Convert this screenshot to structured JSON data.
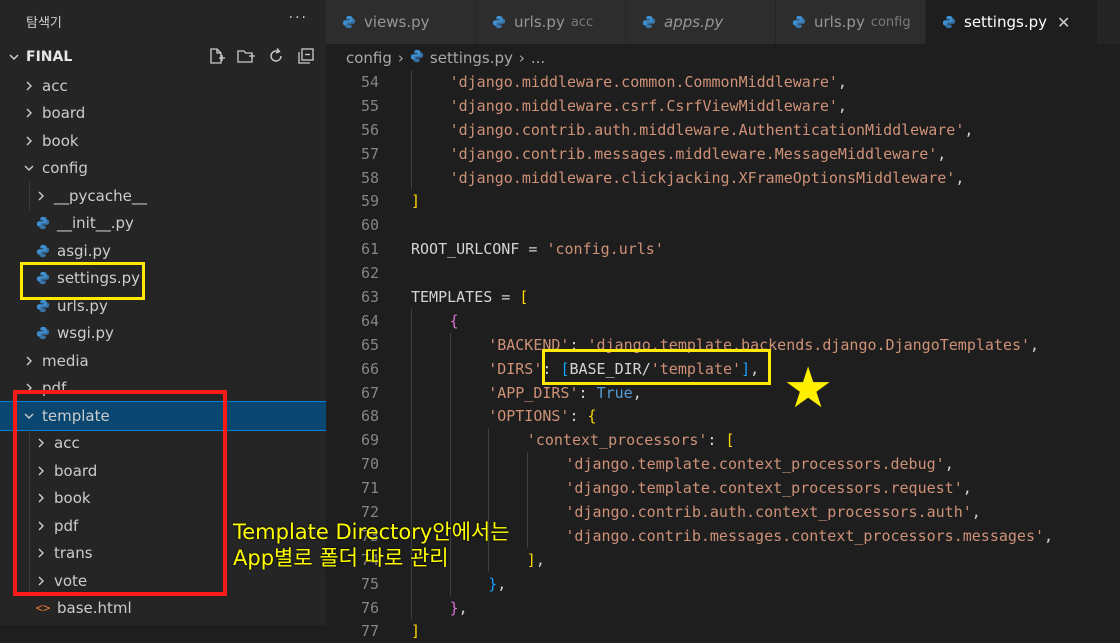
{
  "sidebar": {
    "title": "탐색기",
    "more": "···",
    "section_title": "FINAL",
    "actions": [
      "new-file-icon",
      "new-folder-icon",
      "refresh-icon",
      "collapse-all-icon"
    ],
    "tree": [
      {
        "label": "acc",
        "type": "folder",
        "open": false,
        "level": 0
      },
      {
        "label": "board",
        "type": "folder",
        "open": false,
        "level": 0
      },
      {
        "label": "book",
        "type": "folder",
        "open": false,
        "level": 0
      },
      {
        "label": "config",
        "type": "folder",
        "open": true,
        "level": 0
      },
      {
        "label": "__pycache__",
        "type": "folder",
        "open": false,
        "level": 1
      },
      {
        "label": "__init__.py",
        "type": "py",
        "level": 1
      },
      {
        "label": "asgi.py",
        "type": "py",
        "level": 1
      },
      {
        "label": "settings.py",
        "type": "py",
        "level": 1
      },
      {
        "label": "urls.py",
        "type": "py",
        "level": 1
      },
      {
        "label": "wsgi.py",
        "type": "py",
        "level": 1
      },
      {
        "label": "media",
        "type": "folder",
        "open": false,
        "level": 0
      },
      {
        "label": "pdf",
        "type": "folder",
        "open": false,
        "level": 0
      },
      {
        "label": "template",
        "type": "folder",
        "open": true,
        "level": 0,
        "selected": true
      },
      {
        "label": "acc",
        "type": "folder",
        "open": false,
        "level": 1
      },
      {
        "label": "board",
        "type": "folder",
        "open": false,
        "level": 1
      },
      {
        "label": "book",
        "type": "folder",
        "open": false,
        "level": 1
      },
      {
        "label": "pdf",
        "type": "folder",
        "open": false,
        "level": 1
      },
      {
        "label": "trans",
        "type": "folder",
        "open": false,
        "level": 1
      },
      {
        "label": "vote",
        "type": "folder",
        "open": false,
        "level": 1
      },
      {
        "label": "base.html",
        "type": "html",
        "level": 1
      }
    ]
  },
  "tabs": [
    {
      "label": "views.py",
      "desc": "",
      "italic": false,
      "active": false
    },
    {
      "label": "urls.py",
      "desc": "acc",
      "italic": false,
      "active": false
    },
    {
      "label": "apps.py",
      "desc": "",
      "italic": true,
      "active": false
    },
    {
      "label": "urls.py",
      "desc": "config",
      "italic": false,
      "active": false
    },
    {
      "label": "settings.py",
      "desc": "",
      "italic": false,
      "active": true
    }
  ],
  "breadcrumb": {
    "folder": "config",
    "file": "settings.py",
    "rest": "..."
  },
  "code": [
    {
      "n": "54",
      "i": 1,
      "t": [
        [
          "str",
          "'django.middleware.common.CommonMiddleware'"
        ],
        [
          "op",
          ","
        ]
      ]
    },
    {
      "n": "55",
      "i": 1,
      "t": [
        [
          "str",
          "'django.middleware.csrf.CsrfViewMiddleware'"
        ],
        [
          "op",
          ","
        ]
      ]
    },
    {
      "n": "56",
      "i": 1,
      "t": [
        [
          "str",
          "'django.contrib.auth.middleware.AuthenticationMiddleware'"
        ],
        [
          "op",
          ","
        ]
      ]
    },
    {
      "n": "57",
      "i": 1,
      "t": [
        [
          "str",
          "'django.contrib.messages.middleware.MessageMiddleware'"
        ],
        [
          "op",
          ","
        ]
      ]
    },
    {
      "n": "58",
      "i": 1,
      "t": [
        [
          "str",
          "'django.middleware.clickjacking.XFrameOptionsMiddleware'"
        ],
        [
          "op",
          ","
        ]
      ]
    },
    {
      "n": "59",
      "i": 0,
      "t": [
        [
          "brk-y",
          "]"
        ]
      ]
    },
    {
      "n": "60",
      "i": 0,
      "t": []
    },
    {
      "n": "61",
      "i": 0,
      "t": [
        [
          "ident",
          "ROOT_URLCONF = "
        ],
        [
          "str",
          "'config.urls'"
        ]
      ]
    },
    {
      "n": "62",
      "i": 0,
      "t": []
    },
    {
      "n": "63",
      "i": 0,
      "t": [
        [
          "ident",
          "TEMPLATES = "
        ],
        [
          "brk-y",
          "["
        ]
      ]
    },
    {
      "n": "64",
      "i": 1,
      "t": [
        [
          "brk-p",
          "{"
        ]
      ]
    },
    {
      "n": "65",
      "i": 2,
      "t": [
        [
          "str",
          "'BACKEND'"
        ],
        [
          "op",
          ": "
        ],
        [
          "str",
          "'django.template.backends.django.DjangoTemplates'"
        ],
        [
          "op",
          ","
        ]
      ]
    },
    {
      "n": "66",
      "i": 2,
      "t": [
        [
          "str",
          "'DIRS'"
        ],
        [
          "op",
          ": "
        ],
        [
          "brk-b",
          "["
        ],
        [
          "ident",
          "BASE_DIR/"
        ],
        [
          "str",
          "'template'"
        ],
        [
          "brk-b",
          "]"
        ],
        [
          "op",
          ","
        ]
      ]
    },
    {
      "n": "67",
      "i": 2,
      "t": [
        [
          "str",
          "'APP_DIRS'"
        ],
        [
          "op",
          ": "
        ],
        [
          "kw",
          "True"
        ],
        [
          "op",
          ","
        ]
      ]
    },
    {
      "n": "68",
      "i": 2,
      "t": [
        [
          "str",
          "'OPTIONS'"
        ],
        [
          "op",
          ": "
        ],
        [
          "brk-y",
          "{"
        ]
      ]
    },
    {
      "n": "69",
      "i": 3,
      "t": [
        [
          "str",
          "'context_processors'"
        ],
        [
          "op",
          ": "
        ],
        [
          "brk-y",
          "["
        ]
      ]
    },
    {
      "n": "70",
      "i": 4,
      "t": [
        [
          "str",
          "'django.template.context_processors.debug'"
        ],
        [
          "op",
          ","
        ]
      ]
    },
    {
      "n": "71",
      "i": 4,
      "t": [
        [
          "str",
          "'django.template.context_processors.request'"
        ],
        [
          "op",
          ","
        ]
      ]
    },
    {
      "n": "72",
      "i": 4,
      "t": [
        [
          "str",
          "'django.contrib.auth.context_processors.auth'"
        ],
        [
          "op",
          ","
        ]
      ]
    },
    {
      "n": "73",
      "i": 4,
      "t": [
        [
          "str",
          "'django.contrib.messages.context_processors.messages'"
        ],
        [
          "op",
          ","
        ]
      ]
    },
    {
      "n": "74",
      "i": 3,
      "t": [
        [
          "brk-y",
          "]"
        ],
        [
          "op",
          ","
        ]
      ]
    },
    {
      "n": "75",
      "i": 2,
      "t": [
        [
          "brk-b",
          "}"
        ],
        [
          "op",
          ","
        ]
      ]
    },
    {
      "n": "76",
      "i": 1,
      "t": [
        [
          "brk-p",
          "}"
        ],
        [
          "op",
          ","
        ]
      ]
    },
    {
      "n": "77",
      "i": 0,
      "t": [
        [
          "brk-y",
          "]"
        ]
      ]
    }
  ],
  "annotations": {
    "text_line1": "Template Directory안에서는",
    "text_line2": "App별로 폴더 따로 관리",
    "star": "★"
  },
  "colors": {
    "highlight_yellow": "#ffea00",
    "highlight_red": "#ff1a1a",
    "python_icon": "#3e8ed0",
    "selection": "#094771"
  }
}
